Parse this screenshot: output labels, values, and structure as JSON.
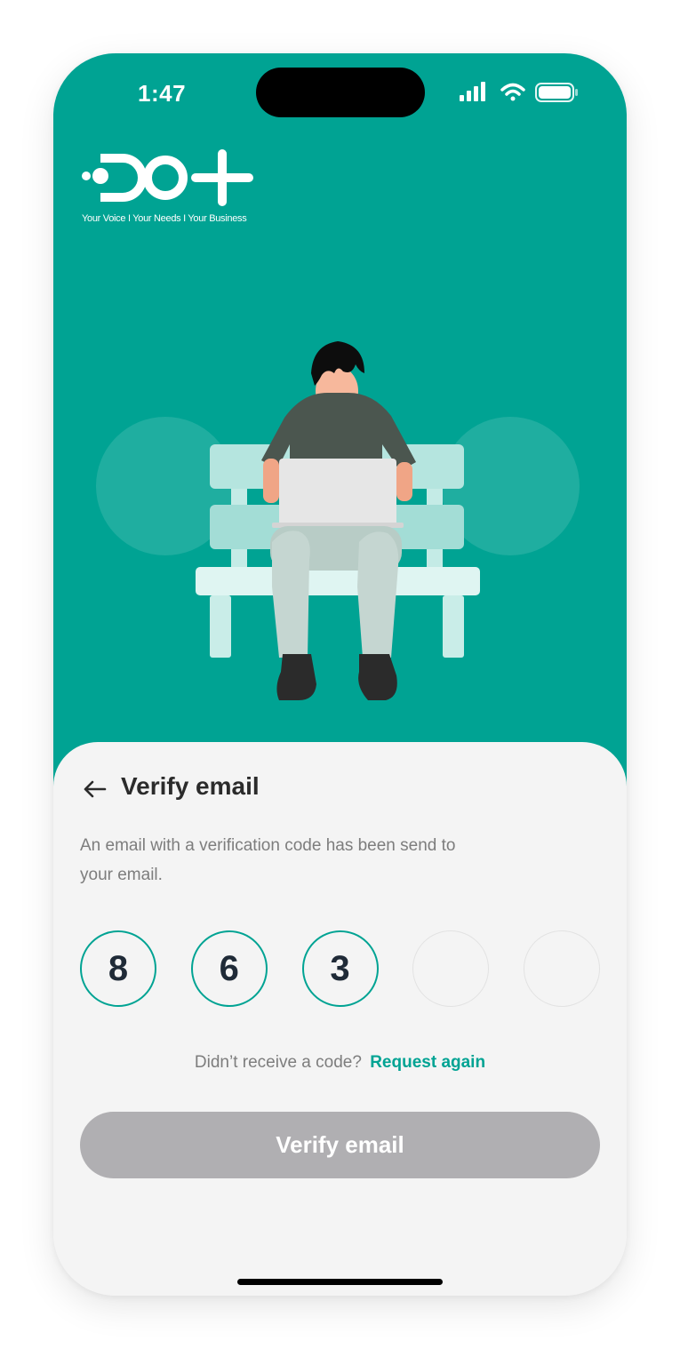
{
  "status_bar": {
    "time": "1:47"
  },
  "brand": {
    "tagline": "Your Voice I Your Needs I Your Business",
    "logo_text": "DO+"
  },
  "header": {
    "title": "Verify email"
  },
  "description": "An email with a verification code has been send to your email.",
  "otp": {
    "digits": [
      "8",
      "6",
      "3",
      "",
      ""
    ]
  },
  "resend": {
    "prompt": "Didn’t receive a code?",
    "link": "Request again"
  },
  "actions": {
    "verify_label": "Verify email"
  },
  "colors": {
    "brand_teal": "#00a393",
    "disabled_button": "#b0afb2",
    "sheet_background": "#f4f4f4",
    "title_text": "#2b2b2b",
    "body_text": "#7d7d7d"
  },
  "icons": [
    "signal-icon",
    "wifi-icon",
    "battery-icon",
    "back-arrow-icon"
  ]
}
